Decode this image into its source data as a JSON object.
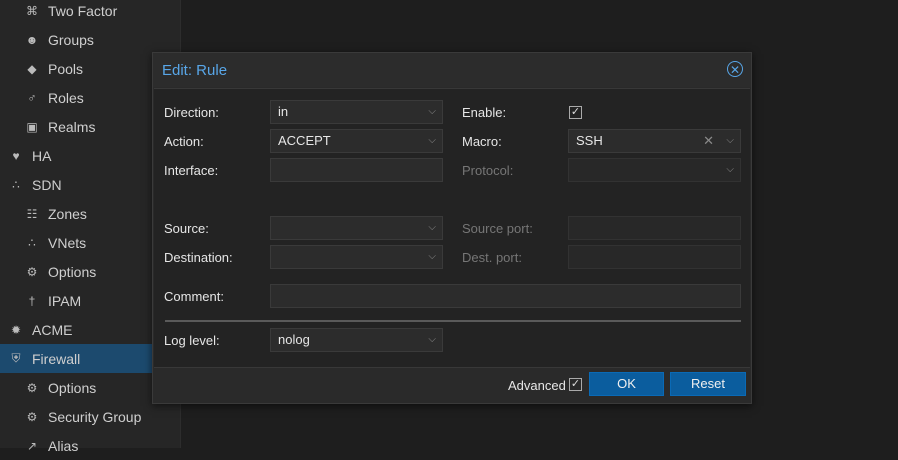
{
  "sidebar": {
    "items": [
      {
        "label": "Two Factor",
        "icon": "key-icon",
        "glyph": "⌘",
        "level": 2
      },
      {
        "label": "Groups",
        "icon": "users-icon",
        "glyph": "☻",
        "level": 2
      },
      {
        "label": "Pools",
        "icon": "tags-icon",
        "glyph": "◆",
        "level": 2
      },
      {
        "label": "Roles",
        "icon": "male-icon",
        "glyph": "♂",
        "level": 2
      },
      {
        "label": "Realms",
        "icon": "address-book-icon",
        "glyph": "▣",
        "level": 2
      },
      {
        "label": "HA",
        "icon": "heartbeat-icon",
        "glyph": "♥",
        "level": 1
      },
      {
        "label": "SDN",
        "icon": "sdn-icon",
        "glyph": "∴",
        "level": 1
      },
      {
        "label": "Zones",
        "icon": "th-icon",
        "glyph": "☷",
        "level": 2
      },
      {
        "label": "VNets",
        "icon": "network-icon",
        "glyph": "∴",
        "level": 2
      },
      {
        "label": "Options",
        "icon": "gear-icon",
        "glyph": "⚙",
        "level": 2
      },
      {
        "label": "IPAM",
        "icon": "map-signs-icon",
        "glyph": "†",
        "level": 2
      },
      {
        "label": "ACME",
        "icon": "certificate-icon",
        "glyph": "✹",
        "level": 1
      },
      {
        "label": "Firewall",
        "icon": "shield-icon",
        "glyph": "⛨",
        "level": 1,
        "active": true
      },
      {
        "label": "Options",
        "icon": "gear-icon",
        "glyph": "⚙",
        "level": 2
      },
      {
        "label": "Security Group",
        "icon": "gear-icon",
        "glyph": "⚙",
        "level": 2
      },
      {
        "label": "Alias",
        "icon": "external-link-icon",
        "glyph": "↗",
        "level": 2
      }
    ]
  },
  "dialog": {
    "title": "Edit: Rule",
    "fields": {
      "direction": {
        "label": "Direction:",
        "value": "in"
      },
      "action": {
        "label": "Action:",
        "value": "ACCEPT"
      },
      "interface": {
        "label": "Interface:",
        "value": ""
      },
      "enable": {
        "label": "Enable:",
        "checked": true
      },
      "macro": {
        "label": "Macro:",
        "value": "SSH"
      },
      "protocol": {
        "label": "Protocol:",
        "value": ""
      },
      "source": {
        "label": "Source:",
        "value": ""
      },
      "destination": {
        "label": "Destination:",
        "value": ""
      },
      "source_port": {
        "label": "Source port:",
        "value": ""
      },
      "dest_port": {
        "label": "Dest. port:",
        "value": ""
      },
      "comment": {
        "label": "Comment:",
        "value": ""
      },
      "log_level": {
        "label": "Log level:",
        "value": "nolog"
      }
    },
    "footer": {
      "advanced_label": "Advanced",
      "advanced_checked": true,
      "ok_label": "OK",
      "reset_label": "Reset"
    }
  },
  "glyphs": {
    "caret": "⌵",
    "check": "✓",
    "clear": "✕",
    "close": "✕"
  },
  "colors": {
    "accent": "#58a6e8",
    "button": "#0b5d9e",
    "active_nav": "#1c4a6e"
  }
}
